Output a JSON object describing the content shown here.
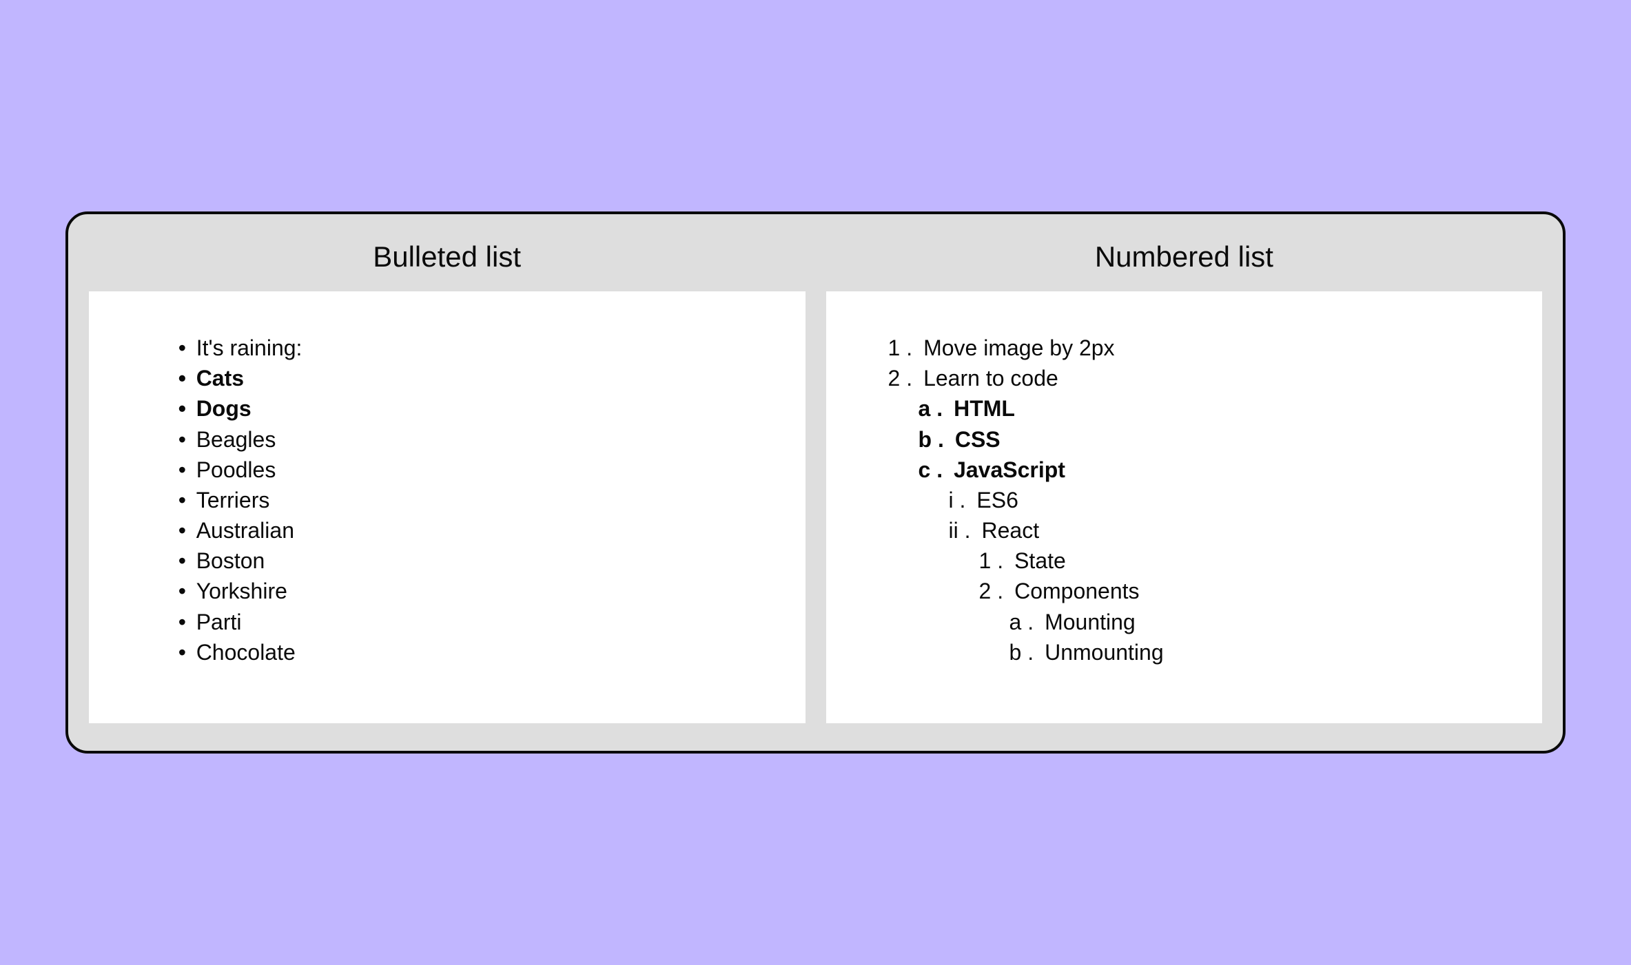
{
  "headers": {
    "left": "Bulleted list",
    "right": "Numbered list"
  },
  "bulleted": {
    "root": "It's raining:",
    "l1a": "Cats",
    "l1b": "Dogs",
    "l2a": "Beagles",
    "l2b": "Poodles",
    "l2c": "Terriers",
    "l3a": "Australian",
    "l3b": "Boston",
    "l3c": "Yorkshire",
    "l4a": "Parti",
    "l4b": "Chocolate"
  },
  "numbered": {
    "n1": {
      "marker": "1 .",
      "text": "Move image by 2px"
    },
    "n2": {
      "marker": "2 .",
      "text": "Learn to code"
    },
    "a": {
      "marker": "a .",
      "text": "HTML"
    },
    "b": {
      "marker": "b .",
      "text": "CSS"
    },
    "c": {
      "marker": "c .",
      "text": "JavaScript"
    },
    "i": {
      "marker": "i .",
      "text": "ES6"
    },
    "ii": {
      "marker": "ii .",
      "text": "React"
    },
    "r1": {
      "marker": "1 .",
      "text": "State"
    },
    "r2": {
      "marker": "2 .",
      "text": "Components"
    },
    "ra": {
      "marker": "a .",
      "text": "Mounting"
    },
    "rb": {
      "marker": "b .",
      "text": "Unmounting"
    }
  }
}
